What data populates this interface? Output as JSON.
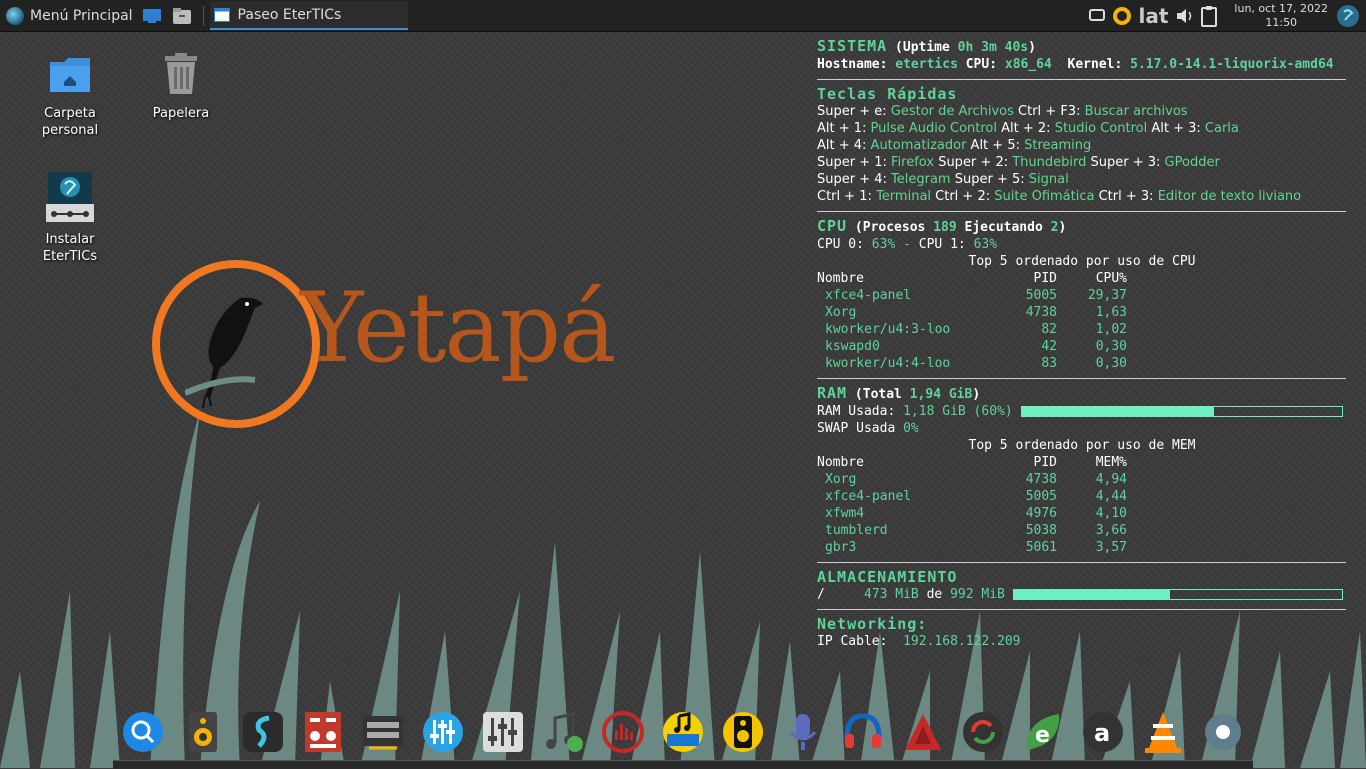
{
  "panel": {
    "menu_label": "Menú Principal",
    "task_title": "Paseo EterTICs",
    "keyboard_layout": "lat",
    "clock_date": "lun, oct 17, 2022",
    "clock_time": "11:50"
  },
  "desktop": {
    "icons": [
      {
        "label": "Carpeta personal",
        "icon": "folder-home-icon"
      },
      {
        "label": "Papelera",
        "icon": "trash-icon"
      },
      {
        "label": "Instalar EterTICs",
        "icon": "installer-icon"
      }
    ],
    "logo_text": "Yetapá"
  },
  "conky": {
    "sistema": {
      "title": "SISTEMA",
      "uptime_label": "Uptime",
      "uptime_value": "0h 3m 40s",
      "hostname_label": "Hostname:",
      "hostname": "etertics",
      "cpu_label": "CPU:",
      "arch": "x86_64",
      "kernel_label": "Kernel:",
      "kernel": "5.17.0-14.1-liquorix-amd64"
    },
    "teclas": {
      "title": "Teclas Rápidas",
      "lines": [
        [
          [
            "Super + e: ",
            "Gestor de Archivos"
          ],
          [
            " Ctrl + F3: ",
            "Buscar archivos"
          ]
        ],
        [
          [
            "Alt + 1: ",
            "Pulse Audio Control"
          ],
          [
            " Alt + 2: ",
            "Studio Control"
          ],
          [
            " Alt + 3: ",
            "Carla"
          ]
        ],
        [
          [
            "Alt + 4: ",
            "Automatizador"
          ],
          [
            " Alt + 5: ",
            "Streaming"
          ]
        ],
        [
          [
            "Super + 1: ",
            "Firefox"
          ],
          [
            " Super + 2: ",
            "Thundebird"
          ],
          [
            " Super + 3: ",
            "GPodder"
          ]
        ],
        [
          [
            "Super + 4: ",
            "Telegram"
          ],
          [
            " Super + 5: ",
            "Signal"
          ]
        ],
        [
          [
            "Ctrl + 1: ",
            "Terminal"
          ],
          [
            " Ctrl + 2: ",
            "Suite Ofimática"
          ],
          [
            " Ctrl + 3: ",
            "Editor de texto liviano"
          ]
        ]
      ]
    },
    "cpu": {
      "title": "CPU",
      "procesos_label": "Procesos",
      "procesos": "189",
      "ejecutando_label": "Ejecutando",
      "ejecutando": "2",
      "cpu0_label": "CPU 0:",
      "cpu0": "63%",
      "cpu1_label": "CPU 1:",
      "cpu1": "63%",
      "top_title": "Top 5 ordenado por uso de CPU",
      "headers": [
        "Nombre",
        "PID",
        "CPU%"
      ],
      "rows": [
        [
          "xfce4-panel",
          "5005",
          "29,37"
        ],
        [
          "Xorg",
          "4738",
          "1,63"
        ],
        [
          "kworker/u4:3-loo",
          "82",
          "1,02"
        ],
        [
          "kswapd0",
          "42",
          "0,30"
        ],
        [
          "kworker/u4:4-loo",
          "83",
          "0,30"
        ]
      ]
    },
    "ram": {
      "title": "RAM",
      "total_label": "Total",
      "total": "1,94 GiB",
      "used_label": "RAM Usada:",
      "used": "1,18 GiB (60%)",
      "used_fraction": 0.6,
      "swap_label": "SWAP Usada",
      "swap": "0%",
      "top_title": "Top 5 ordenado por uso de MEM",
      "headers": [
        "Nombre",
        "PID",
        "MEM%"
      ],
      "rows": [
        [
          "Xorg",
          "4738",
          "4,94"
        ],
        [
          "xfce4-panel",
          "5005",
          "4,44"
        ],
        [
          "xfwm4",
          "4976",
          "4,10"
        ],
        [
          "tumblerd",
          "5038",
          "3,66"
        ],
        [
          "gbr3",
          "5061",
          "3,57"
        ]
      ]
    },
    "storage": {
      "title": "ALMACENAMIENTO",
      "mount": "/",
      "used": "473 MiB",
      "of_label": "de",
      "total": "992 MiB",
      "used_fraction": 0.477
    },
    "net": {
      "title": "Networking:",
      "ip_label": "IP Cable:",
      "ip": "192.168.122.209"
    }
  },
  "dock": [
    "search-icon",
    "speaker-icon",
    "studio-control-icon",
    "audio-mixer-icon",
    "patchbay-icon",
    "equalizer-icon",
    "mixer-sliders-icon",
    "music-note-icon",
    "streaming-icon",
    "music-keyboard-icon",
    "speaker-yellow-icon",
    "microphone-icon",
    "headphones-icon",
    "red-triangle-icon",
    "refresh-icon",
    "e-leaf-icon",
    "a-circle-icon",
    "vlc-icon",
    "settings-icon"
  ],
  "colors": {
    "accent": "#5fd39c",
    "bar": "#6ef0c0",
    "logo_orange": "#f07820",
    "logo_text": "#b5561c"
  }
}
